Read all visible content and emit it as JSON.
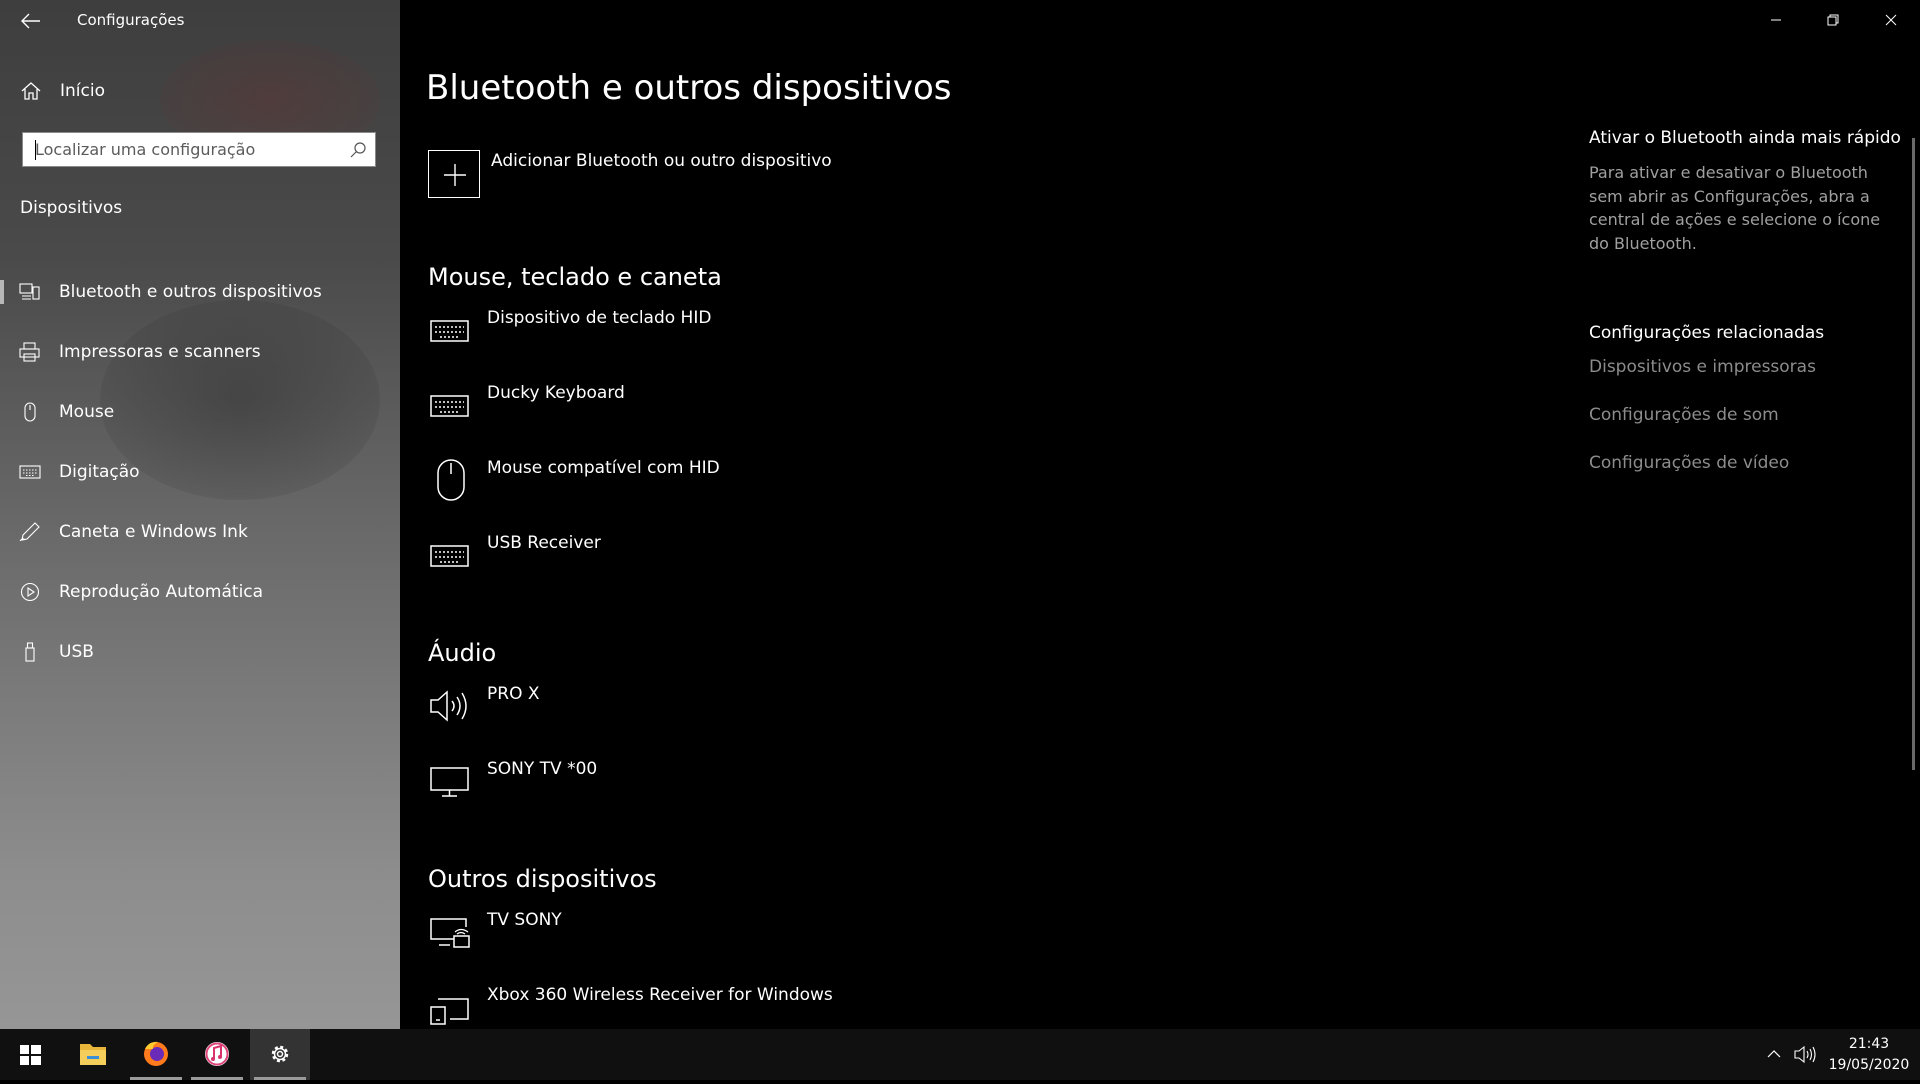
{
  "window": {
    "title": "Configurações"
  },
  "sidebar": {
    "home_label": "Início",
    "search_placeholder": "Localizar uma configuração",
    "section": "Dispositivos",
    "items": [
      {
        "label": "Bluetooth e outros dispositivos",
        "icon": "bluetooth-devices-icon",
        "selected": true
      },
      {
        "label": "Impressoras e scanners",
        "icon": "printer-icon",
        "selected": false
      },
      {
        "label": "Mouse",
        "icon": "mouse-icon",
        "selected": false
      },
      {
        "label": "Digitação",
        "icon": "keyboard-icon",
        "selected": false
      },
      {
        "label": "Caneta e Windows Ink",
        "icon": "pen-icon",
        "selected": false
      },
      {
        "label": "Reprodução Automática",
        "icon": "autoplay-icon",
        "selected": false
      },
      {
        "label": "USB",
        "icon": "usb-icon",
        "selected": false
      }
    ]
  },
  "main": {
    "title": "Bluetooth e outros dispositivos",
    "add_label": "Adicionar Bluetooth ou outro dispositivo",
    "categories": [
      {
        "name": "Mouse, teclado e caneta",
        "devices": [
          {
            "label": "Dispositivo de teclado HID",
            "icon": "keyboard-icon"
          },
          {
            "label": "Ducky Keyboard",
            "icon": "keyboard-icon"
          },
          {
            "label": "Mouse compatível com HID",
            "icon": "mouse-icon"
          },
          {
            "label": "USB Receiver",
            "icon": "keyboard-icon"
          }
        ]
      },
      {
        "name": "Áudio",
        "devices": [
          {
            "label": "PRO X",
            "icon": "speaker-icon"
          },
          {
            "label": "SONY TV  *00",
            "icon": "monitor-icon"
          }
        ]
      },
      {
        "name": "Outros dispositivos",
        "devices": [
          {
            "label": "TV SONY",
            "icon": "network-display-icon"
          },
          {
            "label": "Xbox 360 Wireless Receiver for Windows",
            "icon": "device-icon"
          }
        ]
      }
    ]
  },
  "right": {
    "tip_title": "Ativar o Bluetooth ainda mais rápido",
    "tip_body": "Para ativar e desativar o Bluetooth sem abrir as Configurações, abra a central de ações e selecione o ícone do Bluetooth.",
    "related_title": "Configurações relacionadas",
    "related_links": [
      "Dispositivos e impressoras",
      "Configurações de som",
      "Configurações de vídeo"
    ]
  },
  "taskbar": {
    "apps": [
      "windows-start-icon",
      "file-explorer-icon",
      "firefox-icon",
      "itunes-icon",
      "settings-gear-icon"
    ],
    "active_app": "settings-gear-icon",
    "time": "21:43",
    "date": "19/05/2020"
  }
}
